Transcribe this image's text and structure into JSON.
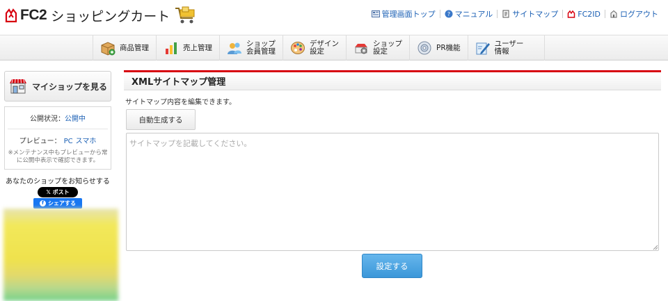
{
  "header": {
    "logo_brand": "FC2",
    "logo_title": "ショッピングカート",
    "links": [
      {
        "label": "管理画面トップ",
        "icon": "dashboard-icon"
      },
      {
        "label": "マニュアル",
        "icon": "help-icon"
      },
      {
        "label": "サイトマップ",
        "icon": "sitemap-icon"
      },
      {
        "label": "FC2ID",
        "icon": "fc2-icon"
      },
      {
        "label": "ログアウト",
        "icon": "logout-icon"
      }
    ]
  },
  "nav": {
    "items": [
      {
        "label": "商品管理",
        "icon": "box-icon"
      },
      {
        "label": "売上管理",
        "icon": "bar-chart-icon"
      },
      {
        "label": "ショップ\n会員管理",
        "label_line1": "ショップ",
        "label_line2": "会員管理",
        "icon": "members-icon"
      },
      {
        "label_line1": "デザイン",
        "label_line2": "設定",
        "icon": "palette-icon"
      },
      {
        "label_line1": "ショップ",
        "label_line2": "設定",
        "icon": "shop-settings-icon"
      },
      {
        "label": "PR機能",
        "icon": "cd-icon"
      },
      {
        "label_line1": "ユーザー",
        "label_line2": "情報",
        "icon": "pen-icon"
      }
    ]
  },
  "sidebar": {
    "myshop_label": "マイショップを見る",
    "status_label": "公開状況：",
    "status_value": "公開中",
    "preview_label": "プレビュー：",
    "preview_pc": "PC",
    "preview_sp": "スマホ",
    "note": "※メンテナンス中もプレビューから常に公開中表示で確認できます。",
    "share_title": "あなたのショップをお知らせする",
    "x_post_label": "𝕏 ポスト",
    "fb_share_label": "シェアする"
  },
  "main": {
    "title": "XMLサイトマップ管理",
    "description": "サイトマップ内容を編集できます。",
    "auto_generate_label": "自動生成する",
    "textarea_placeholder": "サイトマップを記載してください。",
    "textarea_value": "",
    "save_label": "設定する"
  },
  "colors": {
    "accent_red": "#d7000f",
    "link_blue": "#1a5fb4",
    "save_button": "#3b97d9"
  }
}
